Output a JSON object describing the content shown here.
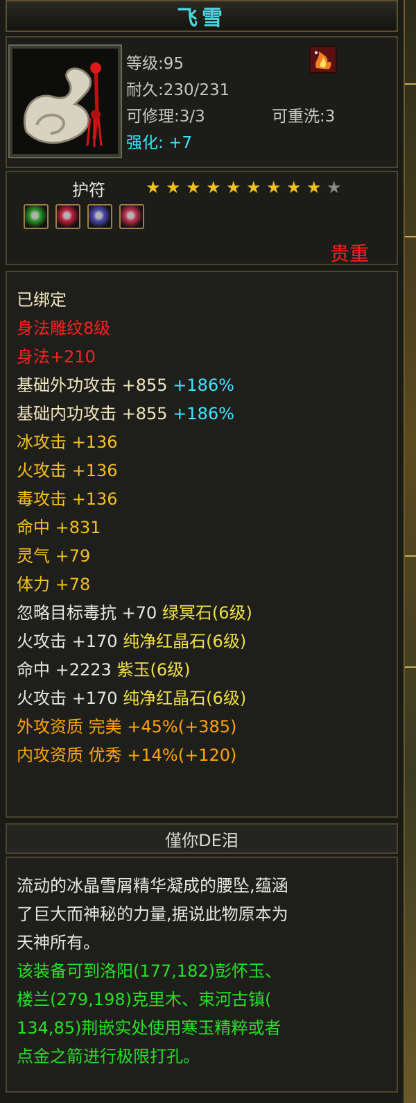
{
  "title": "飞雪",
  "stats": {
    "level": "等级:95",
    "durability": "耐久:230/231",
    "repairable": "可修理:3/3",
    "rewash": "可重洗:3",
    "enhance_label": "强化:",
    "enhance_value": "+7"
  },
  "category": {
    "name": "护符",
    "stars_filled": 9,
    "stars_total": 10,
    "rarity": "贵重"
  },
  "attributes": [
    {
      "text": "已绑定",
      "color": "cream"
    },
    {
      "text": "身法雕纹8级",
      "color": "red"
    },
    {
      "text": "身法+210",
      "color": "red"
    },
    {
      "text": "基础外功攻击  +855 ",
      "extra": "+186%",
      "color": "cream"
    },
    {
      "text": "基础内功攻击  +855 ",
      "extra": "+186%",
      "color": "cream"
    },
    {
      "text": "冰攻击  +136",
      "color": "gold"
    },
    {
      "text": "火攻击  +136",
      "color": "gold"
    },
    {
      "text": "毒攻击  +136",
      "color": "gold"
    },
    {
      "text": "命中  +831",
      "color": "gold"
    },
    {
      "text": "灵气  +79",
      "color": "gold"
    },
    {
      "text": "体力  +78",
      "color": "gold"
    },
    {
      "text": "忽略目标毒抗  +70 ",
      "extra": "绿冥石(6级)",
      "color": "white"
    },
    {
      "text": "火攻击  +170 ",
      "extra": "纯净红晶石(6级)",
      "color": "white"
    },
    {
      "text": "命中  +2223 ",
      "extra": "紫玉(6级)",
      "color": "white"
    },
    {
      "text": "火攻击  +170 ",
      "extra": "纯净红晶石(6级)",
      "color": "white"
    },
    {
      "text": "外攻资质   完美  +45%(+385)",
      "color": "orange"
    },
    {
      "text": "内攻资质   优秀  +14%(+120)",
      "color": "orange"
    }
  ],
  "owner": "僅你DE泪",
  "description": [
    {
      "text": "流动的冰晶雪屑精华凝成的腰坠,蕴涵",
      "color": "white"
    },
    {
      "text": "了巨大而神秘的力量,据说此物原本为",
      "color": "white"
    },
    {
      "text": "天神所有。",
      "color": "white"
    },
    {
      "text": "该装备可到洛阳(177,182)彭怀玉、",
      "color": "green"
    },
    {
      "text": "楼兰(279,198)克里木、束河古镇(",
      "color": "green"
    },
    {
      "text": "134,85)荆嵌实处使用寒玉精粹或者",
      "color": "green"
    },
    {
      "text": "点金之箭进行极限打孔。",
      "color": "green"
    }
  ],
  "gems": [
    {
      "name": "green-gem-icon",
      "color": "#2a9a2a"
    },
    {
      "name": "red-gem-icon",
      "color": "#c02040"
    },
    {
      "name": "purple-gem-icon",
      "color": "#4a4ab0"
    },
    {
      "name": "red-gem-icon",
      "color": "#c03050"
    }
  ],
  "colors": {
    "title": "#4fd6e0",
    "enhance": "#3ee6ff",
    "rarity": "#ff2020"
  }
}
